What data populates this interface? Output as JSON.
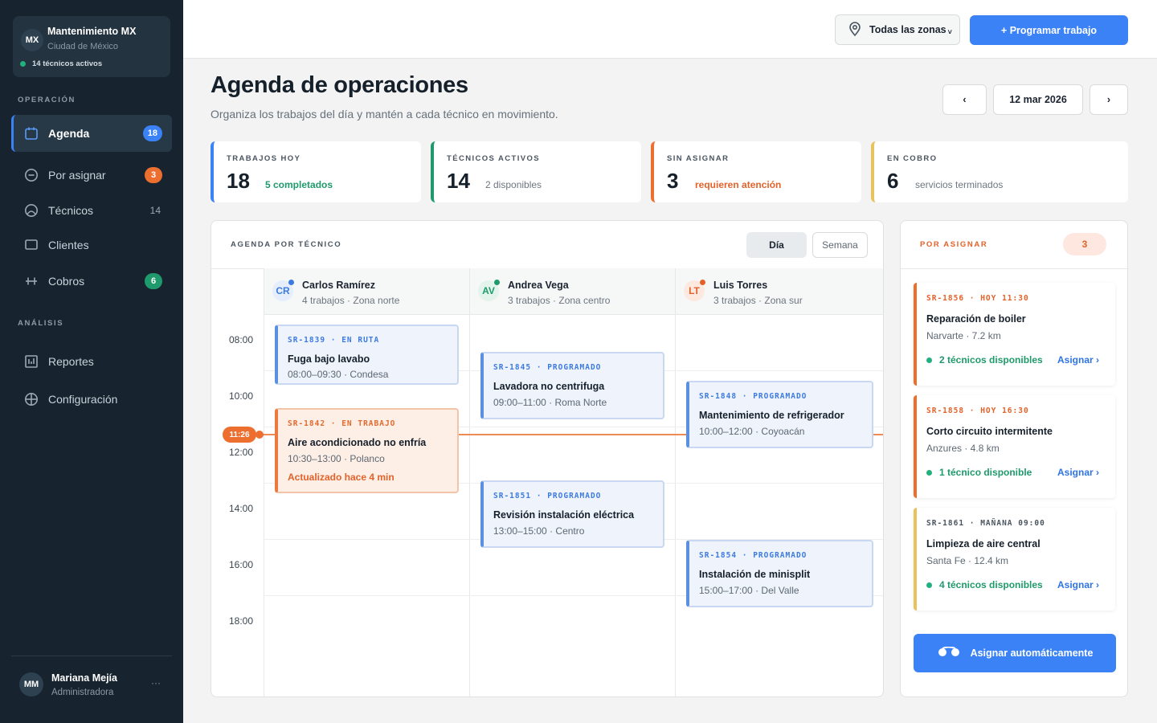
{
  "org": {
    "logo": "MX",
    "name": "Mantenimiento MX",
    "city": "Ciudad de México",
    "active_techs": "14 técnicos activos"
  },
  "sidebar": {
    "section_ops": "OPERACIÓN",
    "section_analysis": "ANÁLISIS",
    "items": [
      {
        "label": "Agenda",
        "icon": "calendar-icon",
        "badge": "18",
        "badge_color": "#3b82f6"
      },
      {
        "label": "Por asignar",
        "icon": "minus-circle-icon",
        "badge": "3",
        "badge_color": "#ec6f30"
      },
      {
        "label": "Técnicos",
        "icon": "person-icon",
        "count": "14"
      },
      {
        "label": "Clientes",
        "icon": "square-icon"
      },
      {
        "label": "Cobros",
        "icon": "cobros-icon",
        "badge": "6",
        "badge_color": "#1f9a6c"
      },
      {
        "label": "Reportes",
        "icon": "report-icon"
      },
      {
        "label": "Configuración",
        "icon": "settings-icon"
      }
    ]
  },
  "user": {
    "initials": "MM",
    "name": "Mariana Mejía",
    "role": "Administradora",
    "more": "···"
  },
  "topbar": {
    "zone_label": "Todas las zonas",
    "program_button": "+ Programar trabajo"
  },
  "header": {
    "title": "Agenda de operaciones",
    "subtitle": "Organiza los trabajos del día y mantén a cada técnico en movimiento.",
    "prev": "‹",
    "date": "12 mar 2026",
    "next": "›"
  },
  "stats": [
    {
      "label": "TRABAJOS HOY",
      "value": "18",
      "detail": "5 completados",
      "color": "#3b82f6",
      "detail_color": "#1f9a6c"
    },
    {
      "label": "TÉCNICOS ACTIVOS",
      "value": "14",
      "detail": "2 disponibles",
      "color": "#1f9a6c",
      "detail_color": "#6c7680"
    },
    {
      "label": "SIN ASIGNAR",
      "value": "3",
      "detail": "requieren atención",
      "color": "#ec6f30",
      "detail_color": "#e2622a"
    },
    {
      "label": "EN COBRO",
      "value": "6",
      "detail": "servicios terminados",
      "color": "#e6c35c",
      "detail_color": "#6c7680"
    }
  ],
  "schedule": {
    "title": "AGENDA POR TÉCNICO",
    "view_day": "Día",
    "view_week": "Semana",
    "times": [
      "08:00",
      "10:00",
      "12:00",
      "14:00",
      "16:00",
      "18:00"
    ],
    "now": "11:26",
    "technicians": [
      {
        "initials": "CR",
        "name": "Carlos Ramírez",
        "info": "4 trabajos · Zona norte",
        "color": "#3e7be0",
        "bg": "#e6eefb"
      },
      {
        "initials": "AV",
        "name": "Andrea Vega",
        "info": "3 trabajos · Zona centro",
        "color": "#1f9a6c",
        "bg": "#e3f4ec"
      },
      {
        "initials": "LT",
        "name": "Luis Torres",
        "info": "3 trabajos · Zona sur",
        "color": "#e2622a",
        "bg": "#fde9df"
      }
    ],
    "jobs": [
      {
        "code": "SR-1839 · EN RUTA",
        "title": "Fuga bajo lavabo",
        "meta": "08:00–09:30 · Condesa"
      },
      {
        "code": "SR-1842 · EN TRABAJO",
        "title": "Aire acondicionado no enfría",
        "meta": "10:30–13:00 · Polanco",
        "note": "Actualizado hace 4 min"
      },
      {
        "code": "SR-1845 · PROGRAMADO",
        "title": "Lavadora no centrifuga",
        "meta": "09:00–11:00 · Roma Norte"
      },
      {
        "code": "SR-1851 · PROGRAMADO",
        "title": "Revisión instalación eléctrica",
        "meta": "13:00–15:00 · Centro"
      },
      {
        "code": "SR-1848 · PROGRAMADO",
        "title": "Mantenimiento de refrigerador",
        "meta": "10:00–12:00 · Coyoacán"
      },
      {
        "code": "SR-1854 · PROGRAMADO",
        "title": "Instalación de minisplit",
        "meta": "15:00–17:00 · Del Valle"
      }
    ]
  },
  "unassigned": {
    "title": "POR ASIGNAR",
    "count": "3",
    "items": [
      {
        "code": "SR-1856 · HOY 11:30",
        "title": "Reparación de boiler",
        "meta": "Narvarte · 7.2 km",
        "available": "2 técnicos disponibles",
        "action": "Asignar ›",
        "color": "#ec6f30"
      },
      {
        "code": "SR-1858 · HOY 16:30",
        "title": "Corto circuito intermitente",
        "meta": "Anzures · 4.8 km",
        "available": "1 técnico disponible",
        "action": "Asignar ›",
        "color": "#ec6f30"
      },
      {
        "code": "SR-1861 · MAÑANA 09:00",
        "title": "Limpieza de aire central",
        "meta": "Santa Fe · 12.4 km",
        "available": "4 técnicos disponibles",
        "action": "Asignar ›",
        "color": "#e6c35c"
      }
    ],
    "auto_button": "Asignar automáticamente"
  }
}
